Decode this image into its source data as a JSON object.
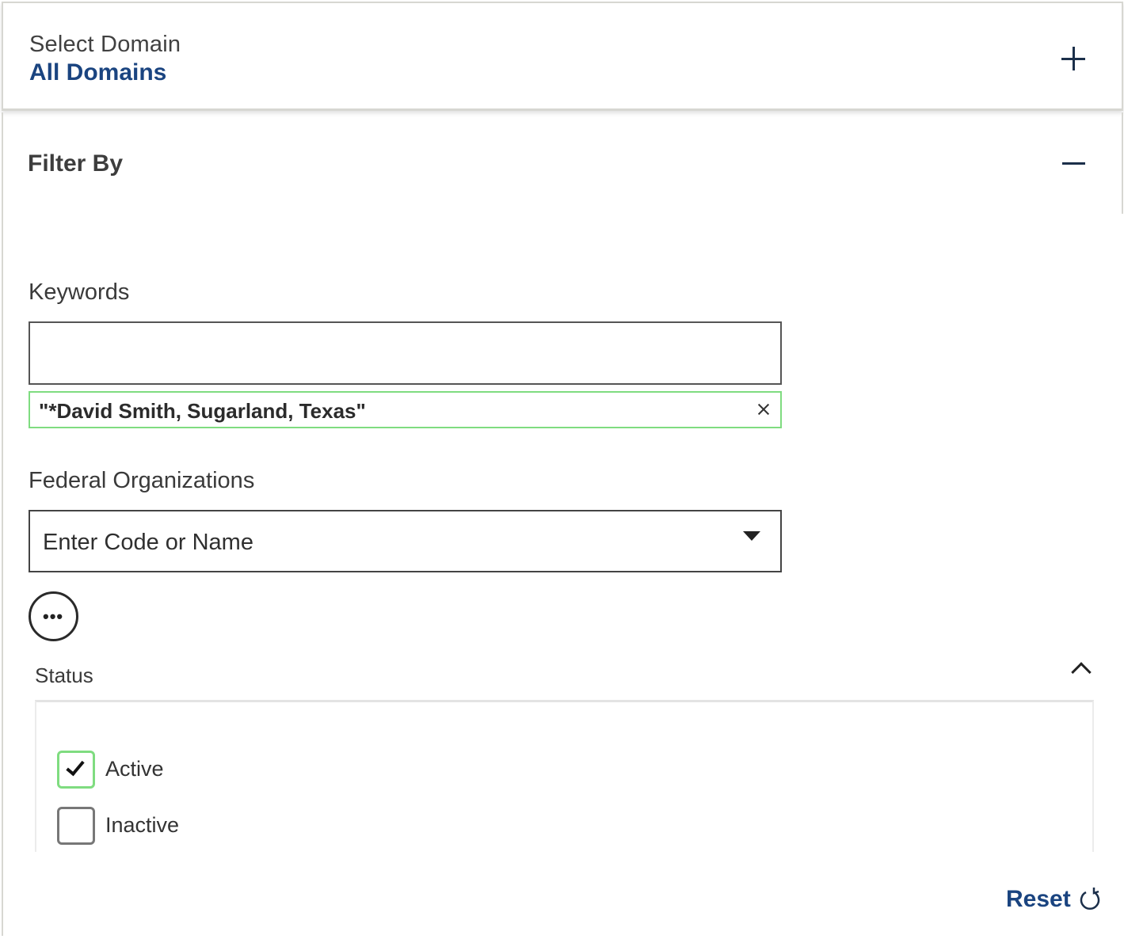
{
  "domain": {
    "label": "Select Domain",
    "value": "All Domains",
    "toggle_icon": "plus-icon"
  },
  "filter": {
    "title": "Filter By",
    "toggle_icon": "minus-icon",
    "keywords": {
      "label": "Keywords",
      "value": "",
      "placeholder": "",
      "chips": [
        {
          "text": "\"*David Smith, Sugarland, Texas\"",
          "remove_icon": "close-icon"
        }
      ]
    },
    "federal_organizations": {
      "label": "Federal Organizations",
      "placeholder": "Enter Code or Name",
      "dropdown_icon": "caret-down-icon",
      "more_icon": "ellipsis-icon"
    },
    "status": {
      "label": "Status",
      "toggle_icon": "chevron-up-icon",
      "options": [
        {
          "label": "Active",
          "checked": true
        },
        {
          "label": "Inactive",
          "checked": false
        }
      ]
    },
    "reset": {
      "label": "Reset",
      "icon": "refresh-icon"
    }
  },
  "colors": {
    "accent": "#1a4480",
    "chip_border": "#7fdc80",
    "panel_border": "#d7d7d2"
  }
}
